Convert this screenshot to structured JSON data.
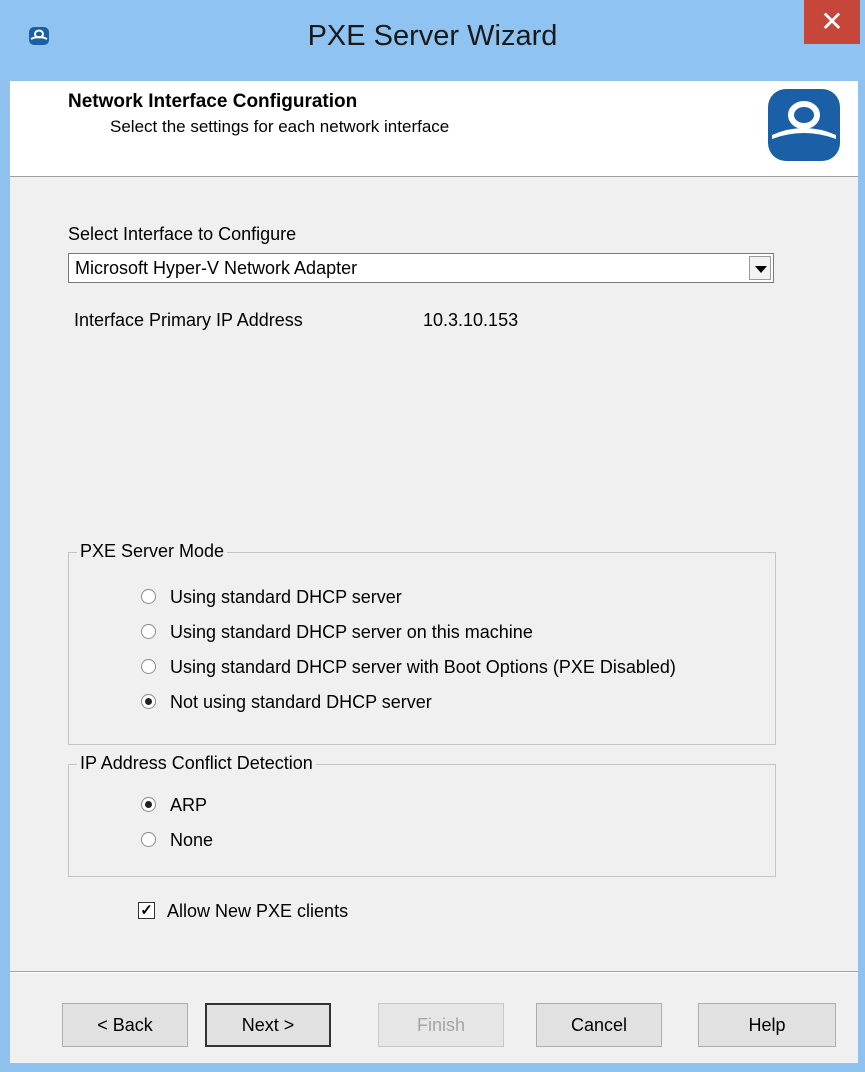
{
  "window": {
    "title": "PXE Server Wizard",
    "close_label": "✕"
  },
  "header": {
    "title": "Network Interface Configuration",
    "subtitle": "Select the settings for each network interface"
  },
  "interface": {
    "select_label": "Select Interface to Configure",
    "selected": "Microsoft Hyper-V Network Adapter",
    "ip_label": "Interface Primary IP Address",
    "ip_value": "10.3.10.153"
  },
  "pxe_mode": {
    "legend": "PXE Server Mode",
    "options": [
      {
        "label": "Using standard DHCP server",
        "checked": false
      },
      {
        "label": "Using standard DHCP server on this machine",
        "checked": false
      },
      {
        "label": "Using standard DHCP server with Boot Options (PXE Disabled)",
        "checked": false
      },
      {
        "label": "Not using standard DHCP server",
        "checked": true
      }
    ]
  },
  "conflict": {
    "legend": "IP Address Conflict Detection",
    "options": [
      {
        "label": "ARP",
        "checked": true
      },
      {
        "label": "None",
        "checked": false
      }
    ]
  },
  "allow_new": {
    "label": "Allow New PXE clients",
    "checked": true,
    "mark": "✓"
  },
  "buttons": {
    "back": "< Back",
    "next": "Next >",
    "finish": "Finish",
    "cancel": "Cancel",
    "help": "Help"
  },
  "colors": {
    "titlebar": "#8fc3f1",
    "close": "#c7463a",
    "dialog": "#f0f0f0",
    "logo_blue": "#1b5fa6"
  },
  "icons": {
    "app": "thinmanager-icon",
    "logo": "thinmanager-logo",
    "dropdown": "chevron-down-icon"
  }
}
